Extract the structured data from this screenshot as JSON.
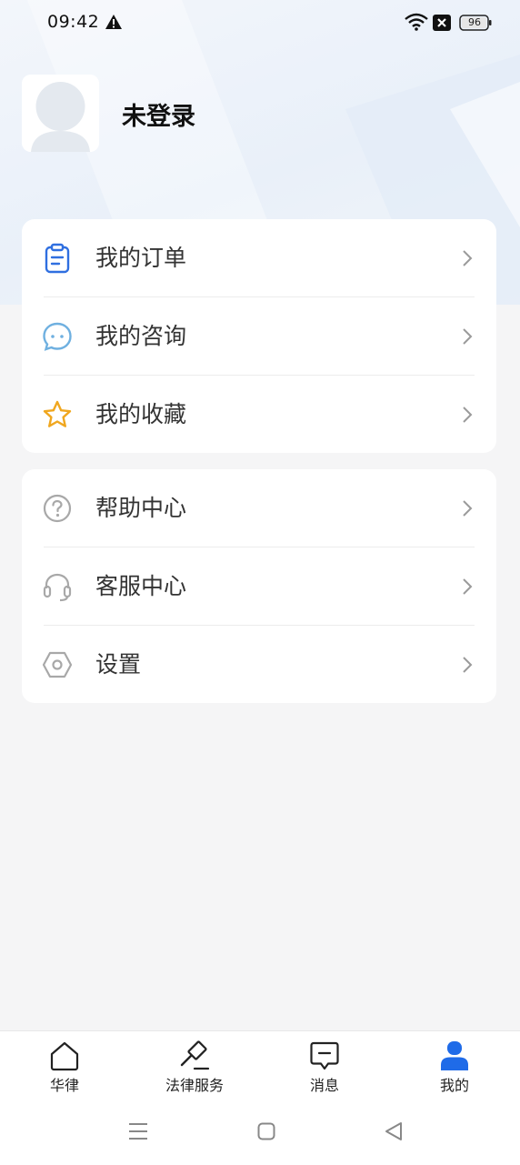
{
  "status_bar": {
    "time": "09:42",
    "battery": "96"
  },
  "profile": {
    "name": "未登录"
  },
  "menu_group_1": [
    {
      "label": "我的订单",
      "icon": "clipboard-icon",
      "color": "#2f6fe0"
    },
    {
      "label": "我的咨询",
      "icon": "chat-bubble-icon",
      "color": "#6fb0e0"
    },
    {
      "label": "我的收藏",
      "icon": "star-icon",
      "color": "#f0a71f"
    }
  ],
  "menu_group_2": [
    {
      "label": "帮助中心",
      "icon": "help-circle-icon",
      "color": "#a8a8a8"
    },
    {
      "label": "客服中心",
      "icon": "headset-icon",
      "color": "#a8a8a8"
    },
    {
      "label": "设置",
      "icon": "settings-hexagon-icon",
      "color": "#a8a8a8"
    }
  ],
  "bottom_nav": [
    {
      "label": "华律",
      "icon": "home-icon"
    },
    {
      "label": "法律服务",
      "icon": "gavel-icon"
    },
    {
      "label": "消息",
      "icon": "message-icon"
    },
    {
      "label": "我的",
      "icon": "user-icon",
      "active": true
    }
  ],
  "colors": {
    "accent": "#1f6be8",
    "background": "#f5f5f6"
  }
}
